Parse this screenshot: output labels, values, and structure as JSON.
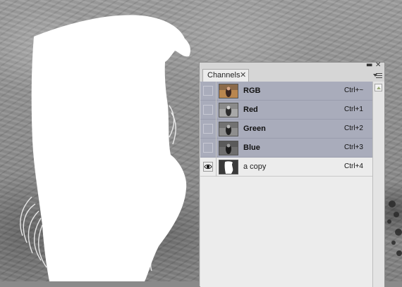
{
  "panel": {
    "minimize_label": "▬",
    "close_label": "✕",
    "tab": {
      "label": "Channels",
      "close_label": "✕"
    },
    "channels": [
      {
        "name": "RGB",
        "shortcut": "Ctrl+~",
        "visible": false,
        "selected": true,
        "thumbnail": "color"
      },
      {
        "name": "Red",
        "shortcut": "Ctrl+1",
        "visible": false,
        "selected": true,
        "thumbnail": "grayscale"
      },
      {
        "name": "Green",
        "shortcut": "Ctrl+2",
        "visible": false,
        "selected": true,
        "thumbnail": "grayscale"
      },
      {
        "name": "Blue",
        "shortcut": "Ctrl+3",
        "visible": false,
        "selected": true,
        "thumbnail": "grayscale"
      },
      {
        "name": "a copy",
        "shortcut": "Ctrl+4",
        "visible": true,
        "selected": false,
        "thumbnail": "mask"
      }
    ]
  },
  "colors": {
    "selected_row": "#a9acbb",
    "panel_bg": "#ececec",
    "mask": "#ffffff"
  },
  "icons": {
    "visibility": "eye-icon",
    "panel_menu": "panel-menu-icon",
    "scroll_up": "scroll-up-arrow-icon"
  }
}
